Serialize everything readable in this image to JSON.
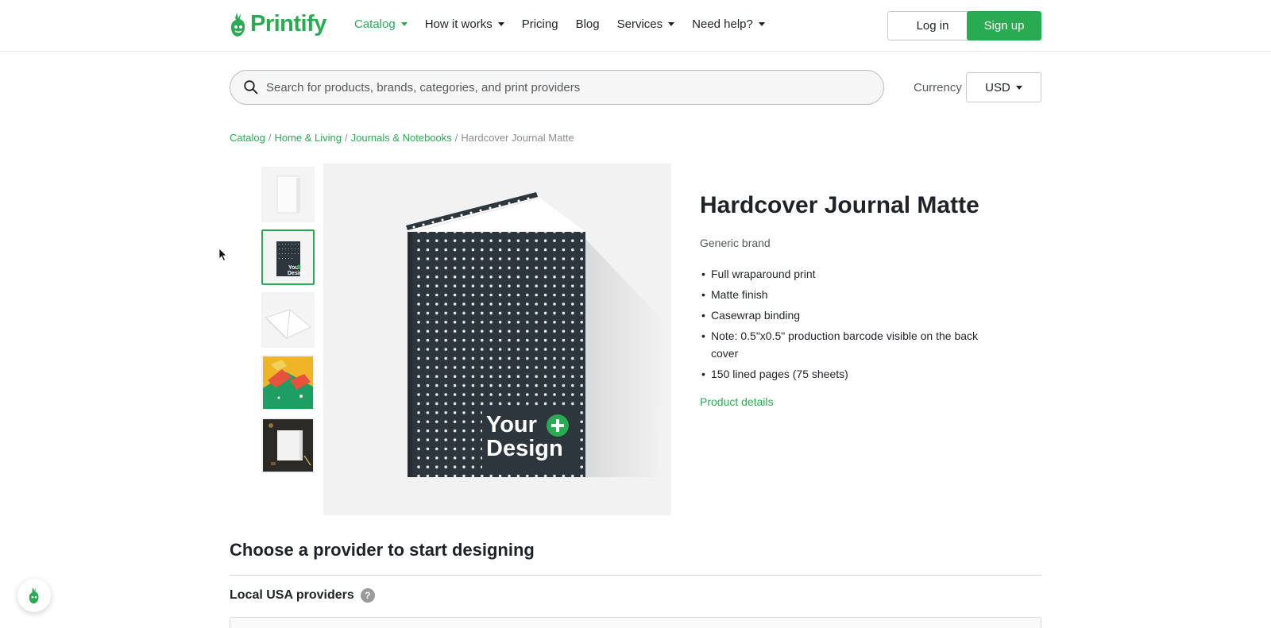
{
  "header": {
    "logo_text": "Printify",
    "nav": [
      {
        "label": "Catalog",
        "dropdown": true,
        "active": true
      },
      {
        "label": "How it works",
        "dropdown": true,
        "active": false
      },
      {
        "label": "Pricing",
        "dropdown": false,
        "active": false
      },
      {
        "label": "Blog",
        "dropdown": false,
        "active": false
      },
      {
        "label": "Services",
        "dropdown": true,
        "active": false
      },
      {
        "label": "Need help?",
        "dropdown": true,
        "active": false
      }
    ],
    "login_label": "Log in",
    "signup_label": "Sign up"
  },
  "search": {
    "placeholder": "Search for products, brands, categories, and print providers",
    "value": ""
  },
  "currency": {
    "label": "Currency",
    "selected": "USD"
  },
  "breadcrumb": {
    "items": [
      "Catalog",
      "Home & Living",
      "Journals & Notebooks"
    ],
    "current": "Hardcover Journal Matte"
  },
  "product": {
    "title": "Hardcover Journal Matte",
    "brand": "Generic brand",
    "features": [
      "Full wraparound print",
      "Matte finish",
      "Casewrap binding",
      "Note: 0.5\"x0.5\" production barcode visible on the back cover",
      "150 lined pages (75 sheets)"
    ],
    "details_link": "Product details",
    "image_badge_line1": "Your",
    "image_badge_line2": "Design",
    "thumbnails": [
      {
        "name": "blank-journal"
      },
      {
        "name": "design-journal",
        "selected": true
      },
      {
        "name": "open-journal"
      },
      {
        "name": "colorful-journal"
      },
      {
        "name": "desk-journal"
      }
    ]
  },
  "providers": {
    "section_title": "Choose a provider to start designing",
    "subsection_title": "Local USA providers",
    "help_symbol": "?"
  },
  "colors": {
    "brand_green": "#29ab51",
    "journal_cover": "#2e363d"
  }
}
